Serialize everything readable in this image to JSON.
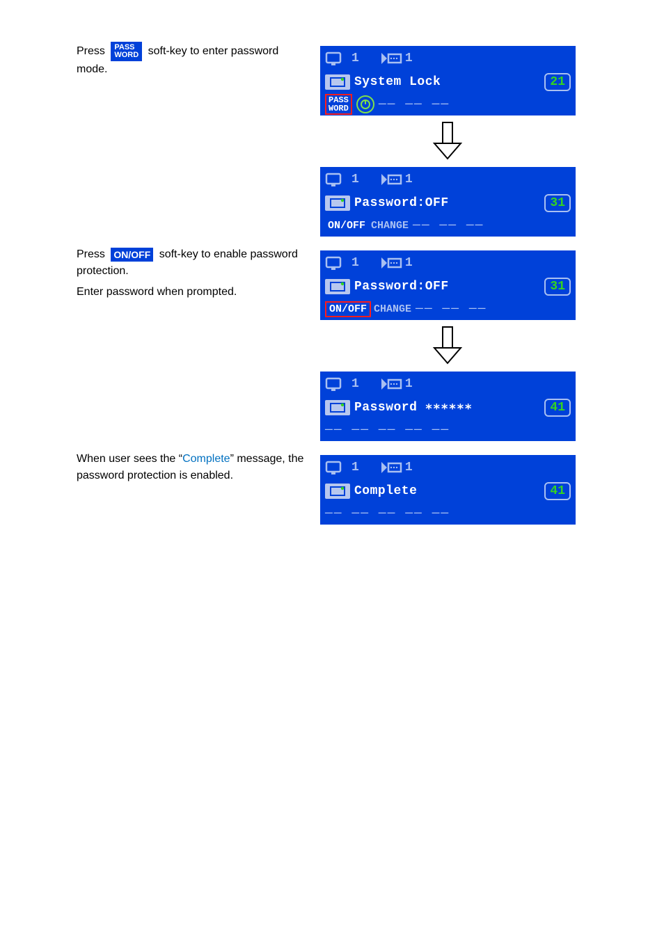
{
  "steps": {
    "s1": {
      "leftPrefix": "Press",
      "softkey": "PASS\nWORD",
      "leftSuffix": "soft-key to enter password mode."
    },
    "s2": {
      "leftPrefix": "Press",
      "softkey": "ON/OFF",
      "leftSuffix": "soft-key to enable password protection.",
      "leftNote": "Enter password when prompted."
    },
    "s3": {
      "leftPrefix": "When user sees the “",
      "completeWord": "Complete",
      "leftSuffix": "” message, the password protection is enabled."
    }
  },
  "lcd": {
    "top": {
      "count": "1",
      "play": "1"
    },
    "screen1": {
      "title": "System Lock",
      "count": "21",
      "row": {
        "passLabel": "PASS\nWORD",
        "clock": "⊙"
      },
      "dash": "—— —— ——"
    },
    "screen2": {
      "title": "Password:OFF",
      "count": "31",
      "row": {
        "onoff": "ON/OFF",
        "change": "CHANGE"
      },
      "dash": "—— —— ——"
    },
    "screen3": {
      "title": "Password:OFF",
      "count": "31",
      "row": {
        "onoff": "ON/OFF",
        "change": "CHANGE"
      },
      "dash": "—— —— ——"
    },
    "screen4": {
      "title": "Password ∗∗∗∗∗∗",
      "count": "41",
      "dash": "—— —— —— —— ——"
    },
    "screen5": {
      "title": "Complete",
      "count": "41",
      "dash": "—— —— —— —— ——"
    }
  }
}
